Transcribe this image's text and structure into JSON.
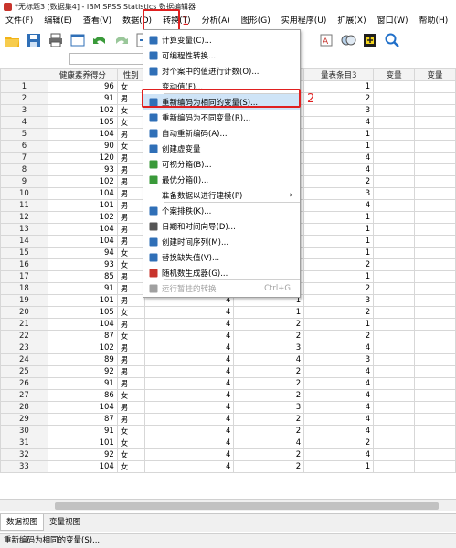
{
  "window": {
    "title": "*无标题3 [数据集4] - IBM SPSS Statistics 数据编辑器"
  },
  "menu": [
    "文件(F)",
    "编辑(E)",
    "查看(V)",
    "数据(D)",
    "转换(T)",
    "分析(A)",
    "图形(G)",
    "实用程序(U)",
    "扩展(X)",
    "窗口(W)",
    "帮助(H)"
  ],
  "annotations": {
    "one": "1",
    "two": "2"
  },
  "columns": [
    "健康素养得分",
    "性别",
    "",
    "",
    "量表条目3",
    "变量",
    "变量"
  ],
  "rows": [
    [
      "1",
      "96",
      "女",
      "",
      "",
      "1"
    ],
    [
      "2",
      "91",
      "男",
      "",
      "",
      "2"
    ],
    [
      "3",
      "102",
      "女",
      "",
      "",
      "3"
    ],
    [
      "4",
      "105",
      "女",
      "",
      "",
      "4"
    ],
    [
      "5",
      "104",
      "男",
      "",
      "",
      "1"
    ],
    [
      "6",
      "90",
      "女",
      "",
      "",
      "1"
    ],
    [
      "7",
      "120",
      "男",
      "",
      "",
      "4"
    ],
    [
      "8",
      "93",
      "男",
      "",
      "",
      "4"
    ],
    [
      "9",
      "102",
      "男",
      "",
      "",
      "2"
    ],
    [
      "10",
      "104",
      "男",
      "",
      "",
      "3"
    ],
    [
      "11",
      "101",
      "男",
      "",
      "",
      "4"
    ],
    [
      "12",
      "102",
      "男",
      "",
      "",
      "1"
    ],
    [
      "13",
      "104",
      "男",
      "",
      "",
      "1"
    ],
    [
      "14",
      "104",
      "男",
      "",
      "",
      "1"
    ],
    [
      "15",
      "94",
      "女",
      "",
      "",
      "1"
    ],
    [
      "16",
      "93",
      "女",
      "",
      "",
      "2"
    ],
    [
      "17",
      "85",
      "男",
      "",
      "",
      "1"
    ],
    [
      "18",
      "91",
      "男",
      "3",
      "2",
      "2"
    ],
    [
      "19",
      "101",
      "男",
      "4",
      "1",
      "3"
    ],
    [
      "20",
      "105",
      "女",
      "4",
      "1",
      "2"
    ],
    [
      "21",
      "104",
      "男",
      "4",
      "2",
      "1"
    ],
    [
      "22",
      "87",
      "女",
      "4",
      "2",
      "2"
    ],
    [
      "23",
      "102",
      "男",
      "4",
      "3",
      "4"
    ],
    [
      "24",
      "89",
      "男",
      "4",
      "4",
      "3"
    ],
    [
      "25",
      "92",
      "男",
      "4",
      "2",
      "4"
    ],
    [
      "26",
      "91",
      "男",
      "4",
      "2",
      "4"
    ],
    [
      "27",
      "86",
      "女",
      "4",
      "2",
      "4"
    ],
    [
      "28",
      "104",
      "男",
      "4",
      "3",
      "4"
    ],
    [
      "29",
      "87",
      "男",
      "4",
      "2",
      "4"
    ],
    [
      "30",
      "91",
      "女",
      "4",
      "2",
      "4"
    ],
    [
      "31",
      "101",
      "女",
      "4",
      "4",
      "2"
    ],
    [
      "32",
      "92",
      "女",
      "4",
      "2",
      "4"
    ],
    [
      "33",
      "104",
      "女",
      "4",
      "2",
      "1"
    ]
  ],
  "dropdown": {
    "items": [
      {
        "label": "计算变量(C)...",
        "icon": "calculator-icon",
        "disabled": false
      },
      {
        "label": "可编程性转换...",
        "icon": "programmability-icon",
        "disabled": false
      },
      {
        "label": "对个案中的值进行计数(O)...",
        "icon": "count-icon",
        "disabled": false
      },
      {
        "label": "变动值(F)...",
        "icon": "",
        "disabled": false
      },
      {
        "label": "重新编码为相同的变量(S)...",
        "icon": "recode-same-icon",
        "disabled": false
      },
      {
        "label": "重新编码为不同变量(R)...",
        "icon": "recode-different-icon",
        "disabled": false
      },
      {
        "label": "自动重新编码(A)...",
        "icon": "auto-recode-icon",
        "disabled": false
      },
      {
        "label": "创建虚变量",
        "icon": "dummy-variable-icon",
        "disabled": false
      },
      {
        "label": "可视分箱(B)...",
        "icon": "visual-binning-icon",
        "disabled": false
      },
      {
        "label": "最优分箱(I)...",
        "icon": "optimal-binning-icon",
        "disabled": false
      },
      {
        "label": "准备数据以进行建模(P)",
        "icon": "",
        "disabled": false,
        "submenu": true
      },
      {
        "label": "个案排秩(K)...",
        "icon": "rank-cases-icon",
        "disabled": false
      },
      {
        "label": "日期和时间向导(D)...",
        "icon": "date-time-icon",
        "disabled": false
      },
      {
        "label": "创建时间序列(M)...",
        "icon": "time-series-icon",
        "disabled": false
      },
      {
        "label": "替换缺失值(V)...",
        "icon": "replace-missing-icon",
        "disabled": false
      },
      {
        "label": "随机数生成器(G)...",
        "icon": "random-generator-icon",
        "disabled": false
      },
      {
        "label": "运行暂挂的转换",
        "icon": "run-pending-icon",
        "disabled": true,
        "shortcut": "Ctrl+G"
      }
    ]
  },
  "tabs": [
    "数据视图",
    "变量视图"
  ],
  "status": "重新编码为相同的变量(S)...",
  "colors": {
    "accent_red": "#e02020",
    "hover_blue": "#cfe4f7"
  }
}
